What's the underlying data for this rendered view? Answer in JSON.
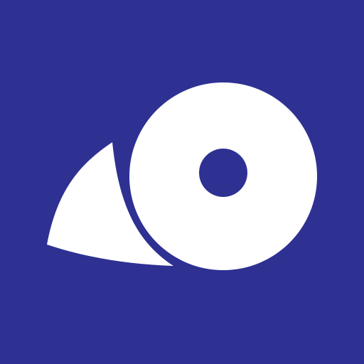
{
  "icon": {
    "name": "disc-logo-icon",
    "colors": {
      "background": "#2e3192",
      "foreground": "#ffffff"
    }
  }
}
